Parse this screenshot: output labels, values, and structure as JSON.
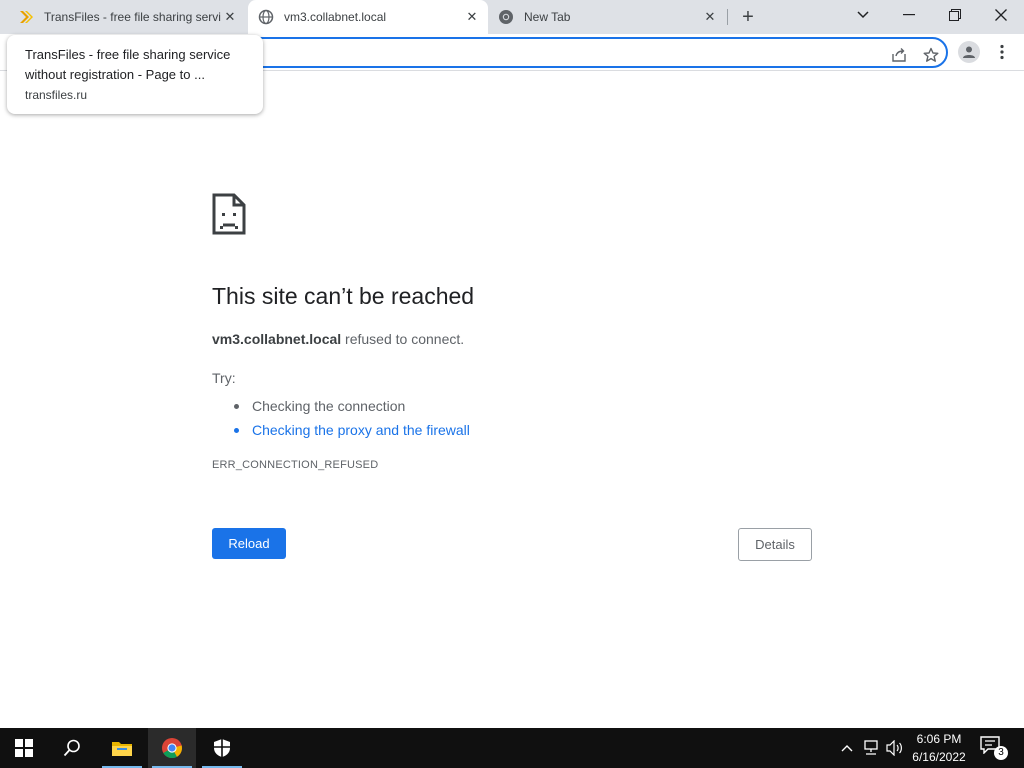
{
  "browser": {
    "tabs": [
      {
        "title": "TransFiles - free file sharing servi",
        "icon": "transfiles-favicon"
      },
      {
        "title": "vm3.collabnet.local",
        "icon": "globe-icon"
      },
      {
        "title": "New Tab",
        "icon": "chrome-icon"
      }
    ],
    "new_tab_label": "+",
    "hovercard": {
      "title": "TransFiles - free file sharing service without registration - Page to ...",
      "domain": "transfiles.ru"
    },
    "omnibox_value": ""
  },
  "error_page": {
    "heading": "This site can’t be reached",
    "host": "vm3.collabnet.local",
    "message": " refused to connect.",
    "try_label": "Try:",
    "suggestions": [
      {
        "text": "Checking the connection",
        "link": false
      },
      {
        "text": "Checking the proxy and the firewall",
        "link": true
      }
    ],
    "error_code": "ERR_CONNECTION_REFUSED",
    "reload_label": "Reload",
    "details_label": "Details"
  },
  "taskbar": {
    "time": "6:06 PM",
    "date": "6/16/2022",
    "notification_count": "3",
    "apps": [
      "start-icon",
      "search-icon",
      "file-explorer-icon",
      "chrome-icon",
      "security-icon"
    ]
  },
  "colors": {
    "accent": "#1a73e8",
    "tabstrip": "#dee1e6",
    "taskbar": "#101010"
  }
}
